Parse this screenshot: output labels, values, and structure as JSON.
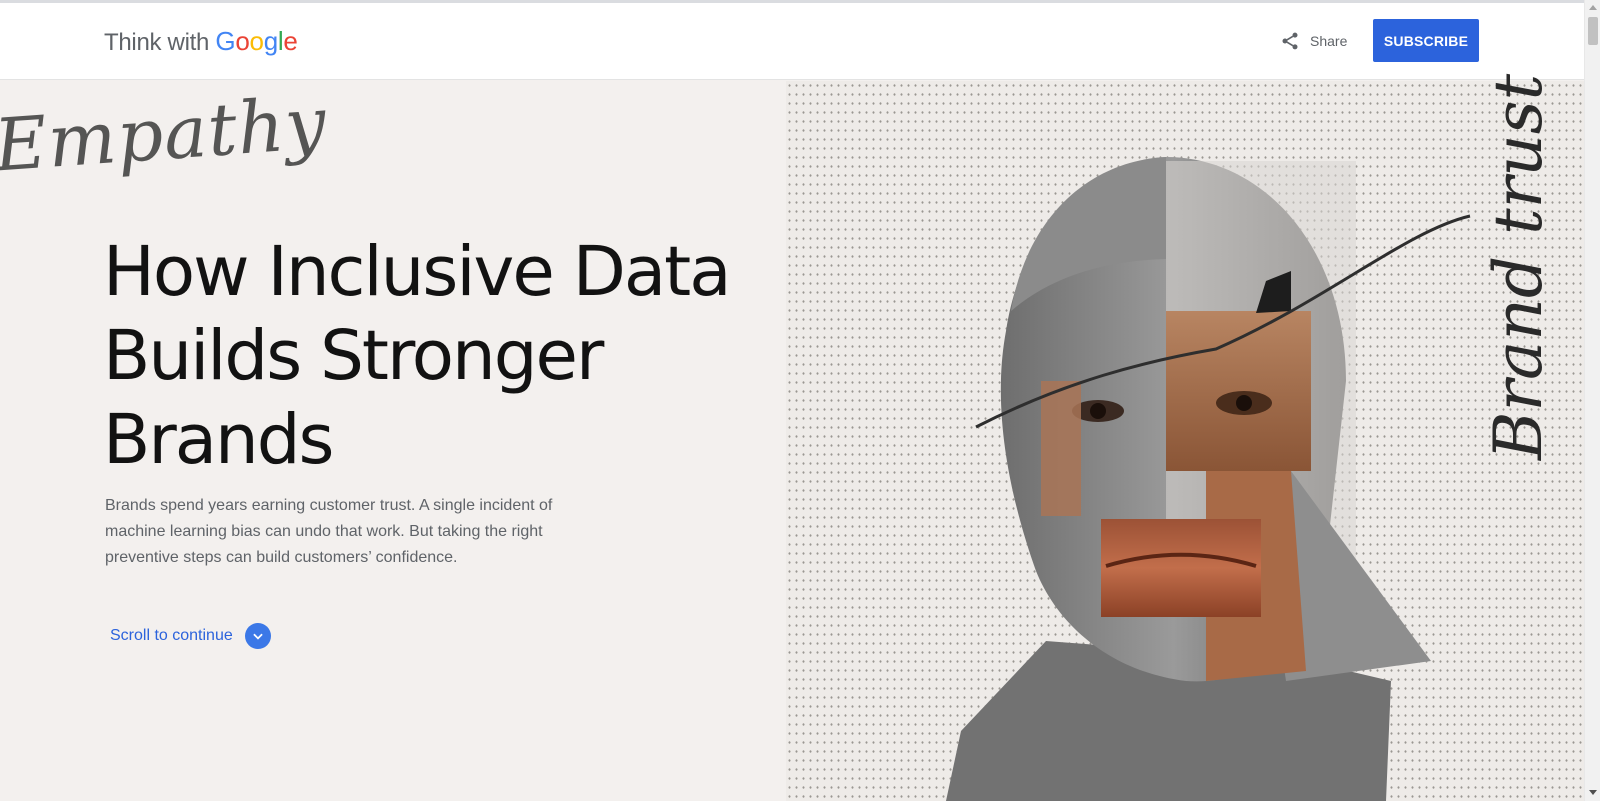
{
  "header": {
    "logo_prefix": "Think with ",
    "logo_brand": [
      "G",
      "o",
      "o",
      "g",
      "l",
      "e"
    ],
    "brand_colors": [
      "#4285F4",
      "#EA4335",
      "#FBBC05",
      "#4285F4",
      "#34A853",
      "#EA4335"
    ],
    "share_label": "Share",
    "share_icon": "share-icon",
    "subscribe_label": "SUBSCRIBE"
  },
  "hero": {
    "script_word_left": "Empathy",
    "headline": "How Inclusive Data Builds Stronger Brands",
    "subtitle": "Brands spend years earning customer trust. A single incident of machine learning bias can undo that work. But taking the right preventive steps can build customers’ confidence.",
    "scroll_label": "Scroll to continue",
    "scroll_icon": "chevron-down-icon",
    "script_word_right": "Brand trust"
  },
  "colors": {
    "accent": "#2c63dc",
    "page_bg": "#f3f0ee",
    "headline": "#121212",
    "body_text": "#5f6368"
  }
}
